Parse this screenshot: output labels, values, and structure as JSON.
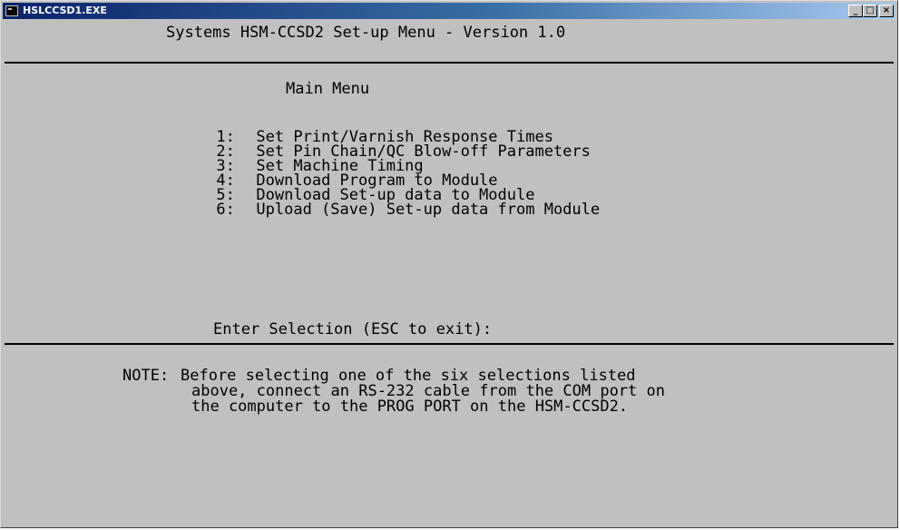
{
  "window": {
    "title": "HSLCCSD1.EXE",
    "controls": {
      "minimize": "_",
      "maximize": "□",
      "close": "×"
    }
  },
  "console": {
    "header": "Systems HSM-CCSD2 Set-up Menu - Version 1.0",
    "menu_title": "Main Menu",
    "menu_items": [
      {
        "num": "1:",
        "label": "Set Print/Varnish Response Times"
      },
      {
        "num": "2:",
        "label": "Set Pin Chain/QC Blow-off Parameters"
      },
      {
        "num": "3:",
        "label": "Set Machine Timing"
      },
      {
        "num": "4:",
        "label": "Download Program to Module"
      },
      {
        "num": "5:",
        "label": "Download Set-up data to Module"
      },
      {
        "num": "6:",
        "label": "Upload (Save) Set-up data from Module"
      }
    ],
    "prompt": "Enter Selection (ESC to exit):",
    "note": {
      "prefix": "NOTE:",
      "lines": [
        "Before selecting one of the six selections listed",
        "above, connect an RS-232 cable from the COM port on",
        "the computer to the PROG PORT on the HSM-CCSD2."
      ]
    }
  }
}
